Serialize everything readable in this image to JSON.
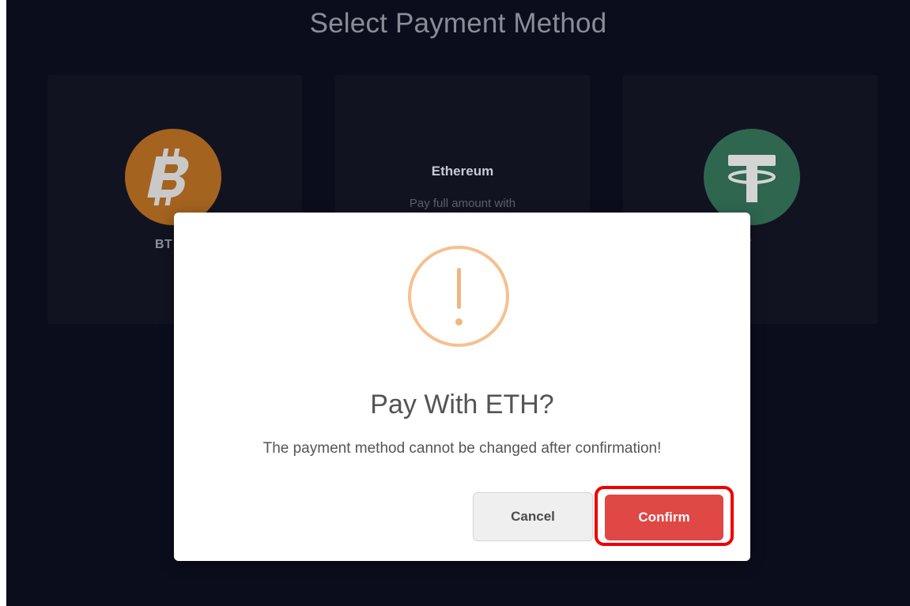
{
  "page": {
    "title": "Select Payment Method"
  },
  "methods": [
    {
      "label": "BT",
      "icon": "bitcoin-icon",
      "color": "#a4631f"
    },
    {
      "name": "Ethereum",
      "description": "Pay full amount with"
    },
    {
      "label": "DT",
      "icon": "tether-icon",
      "color": "#2f6650"
    }
  ],
  "modal": {
    "icon": "warning-icon",
    "title": "Pay With ETH?",
    "message": "The payment method cannot be changed after confirmation!",
    "cancel_label": "Cancel",
    "confirm_label": "Confirm",
    "confirm_color": "#df4845",
    "highlight_color": "#ee0000"
  }
}
